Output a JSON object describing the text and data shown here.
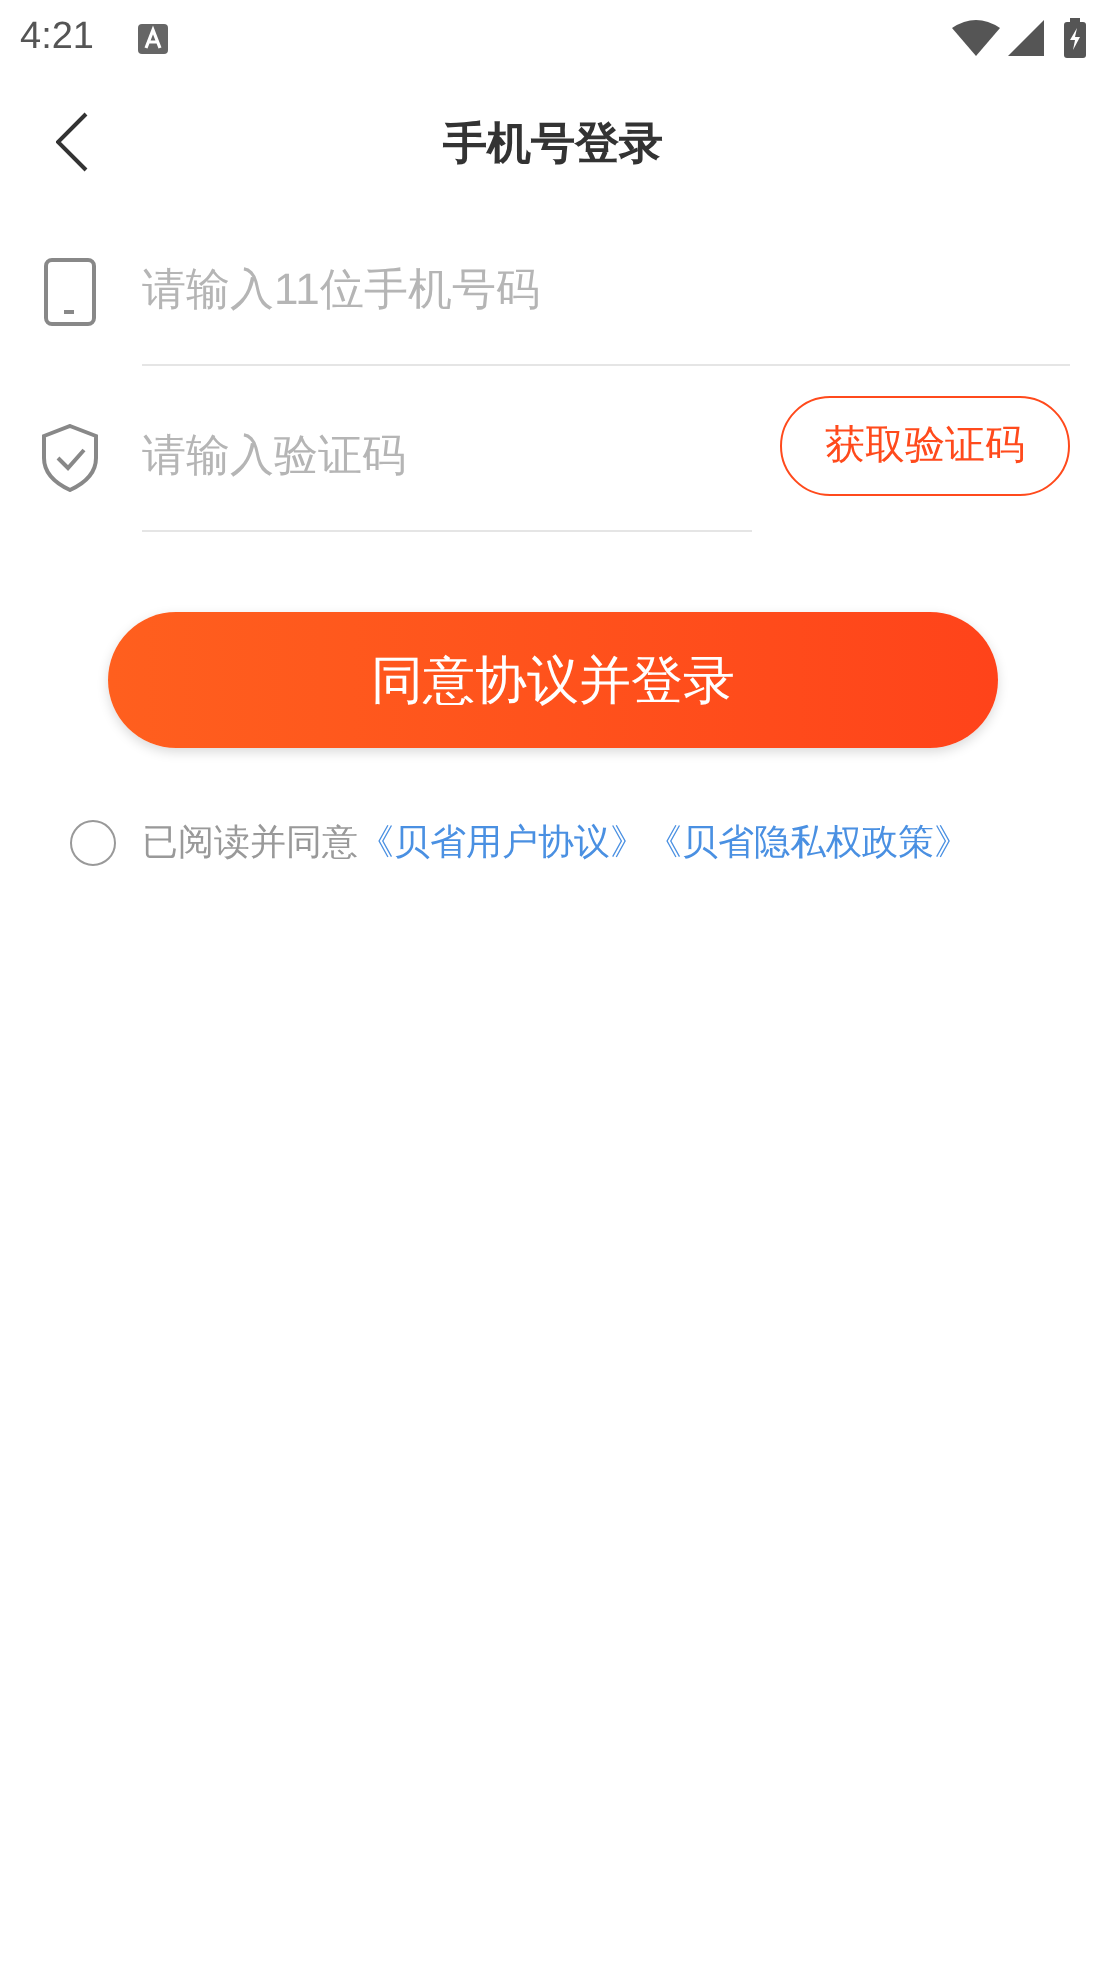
{
  "status_bar": {
    "time": "4:21"
  },
  "header": {
    "title": "手机号登录"
  },
  "phone_field": {
    "placeholder": "请输入11位手机号码"
  },
  "code_field": {
    "placeholder": "请输入验证码"
  },
  "get_code_button": {
    "label": "获取验证码"
  },
  "login_button": {
    "label": "同意协议并登录"
  },
  "agreement": {
    "checked": false,
    "text": "已阅读并同意",
    "links": [
      "《贝省用户协议》",
      "《贝省隐私权政策》"
    ]
  }
}
